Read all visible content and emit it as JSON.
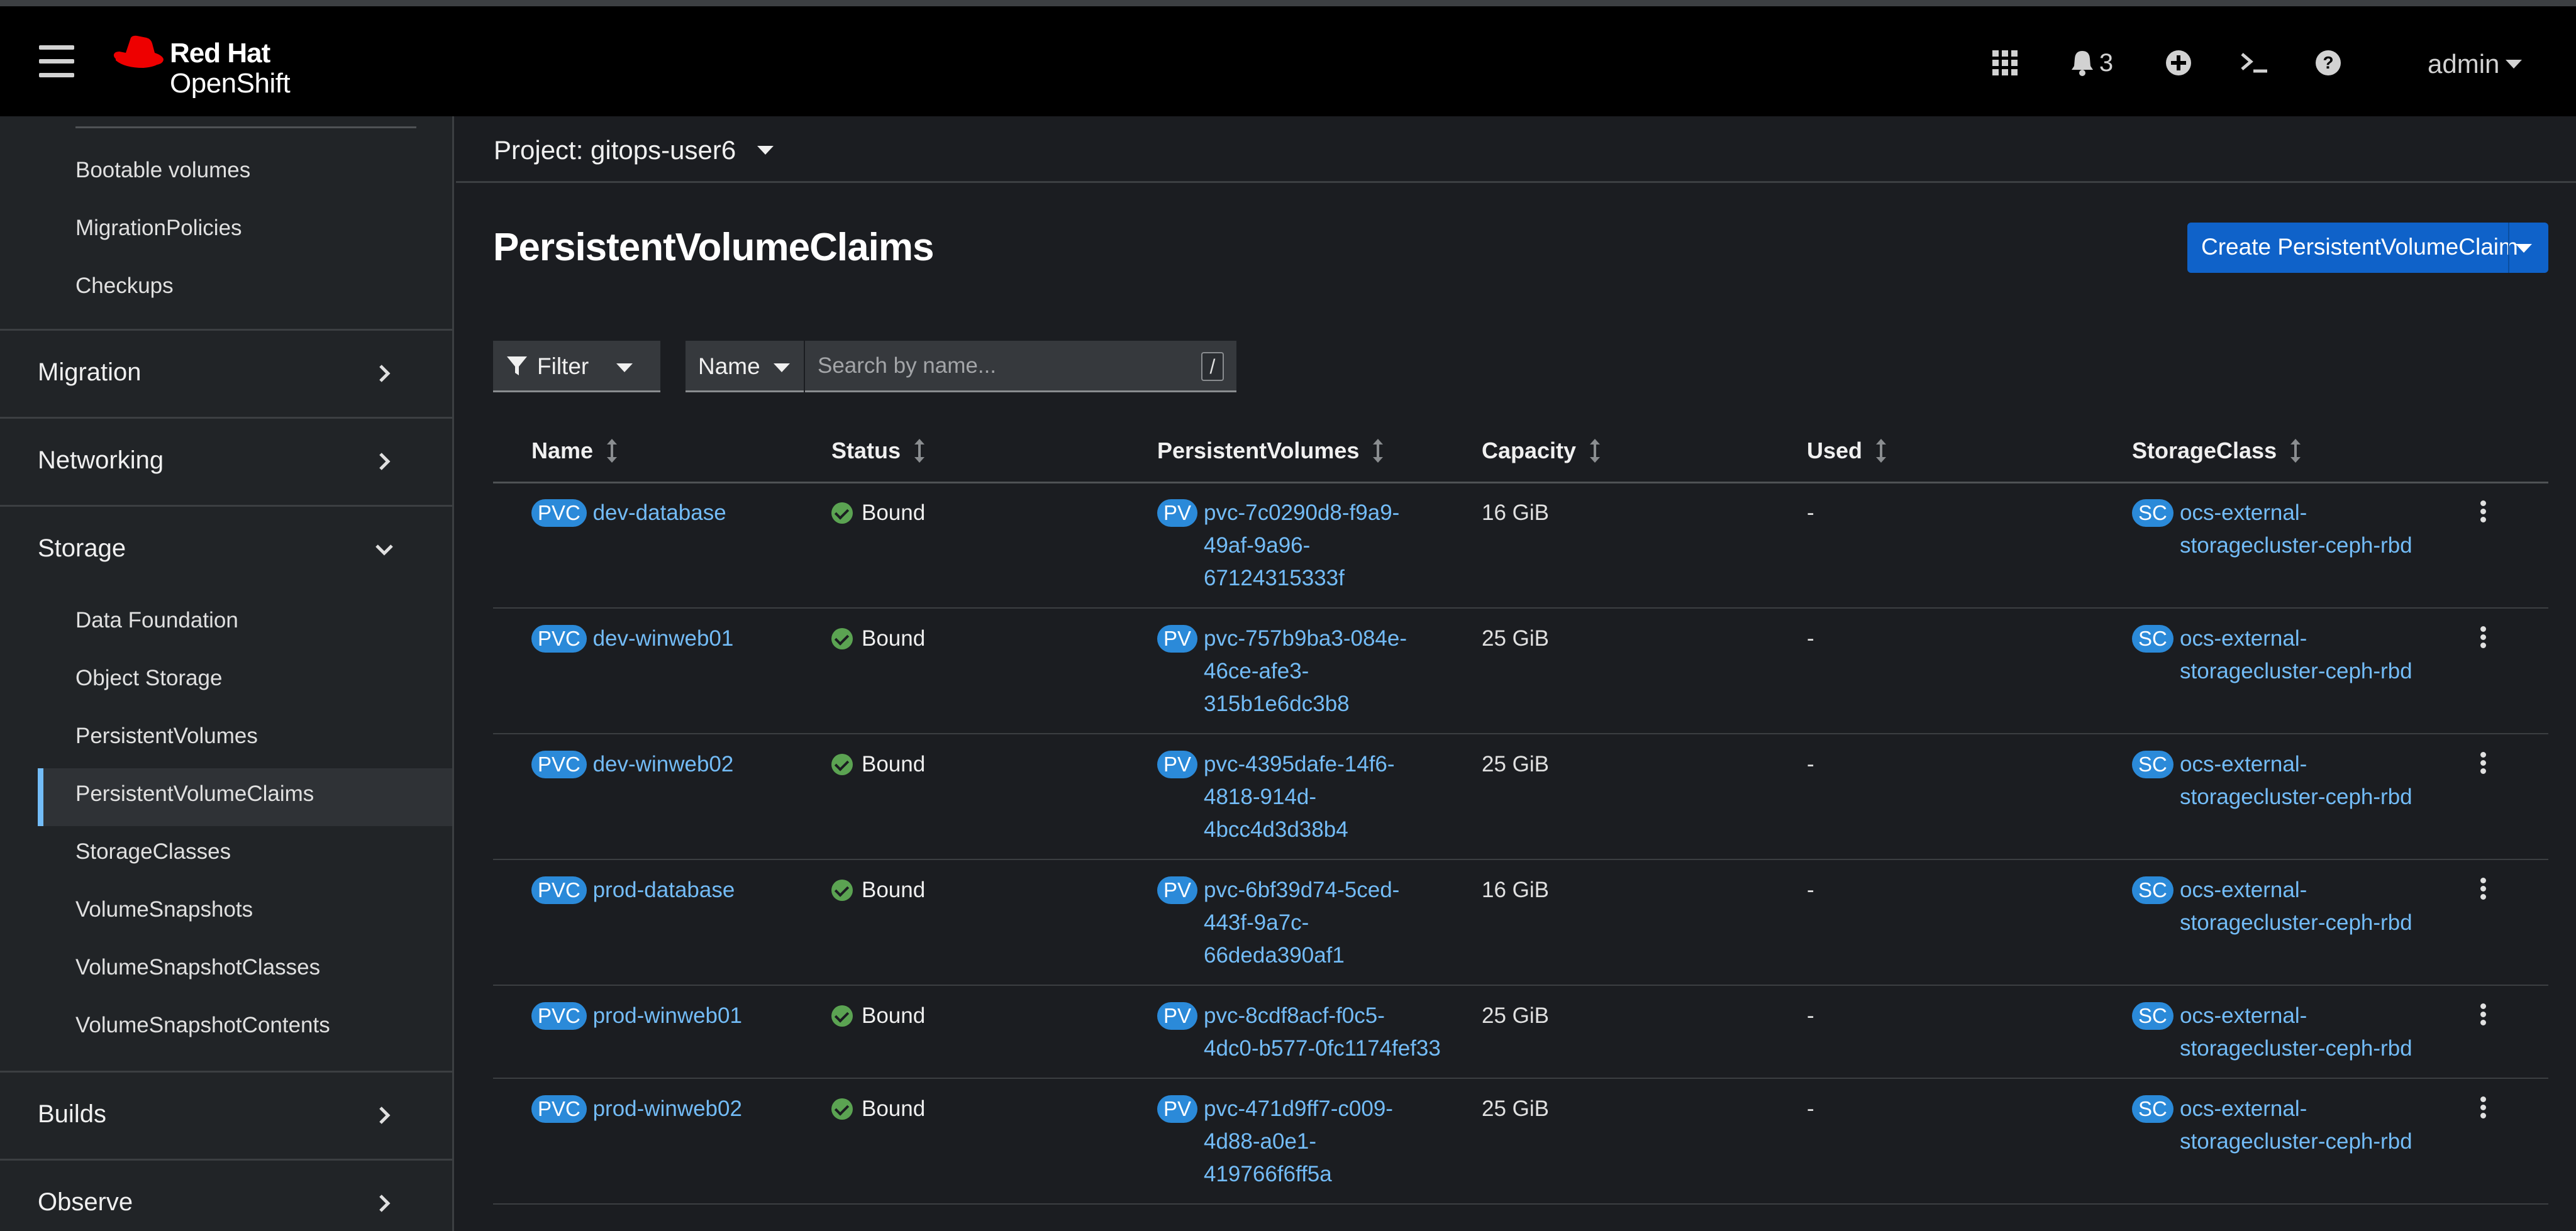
{
  "masthead": {
    "brand_line1": "Red Hat",
    "brand_line2": "OpenShift",
    "icons": [
      "app-launcher-icon",
      "bell-icon",
      "plus-circle-icon",
      "terminal-icon",
      "help-icon"
    ],
    "notification_count": "3",
    "user": "admin"
  },
  "sidebar": {
    "sub_items_top": [
      {
        "label": "Bootable volumes"
      },
      {
        "label": "MigrationPolicies"
      },
      {
        "label": "Checkups"
      }
    ],
    "sections": [
      {
        "label": "Migration",
        "expanded": false
      },
      {
        "label": "Networking",
        "expanded": false
      },
      {
        "label": "Storage",
        "expanded": true
      },
      {
        "label": "Builds",
        "expanded": false
      },
      {
        "label": "Observe",
        "expanded": false
      }
    ],
    "storage_items": [
      {
        "label": "Data Foundation"
      },
      {
        "label": "Object Storage"
      },
      {
        "label": "PersistentVolumes"
      },
      {
        "label": "PersistentVolumeClaims",
        "active": true
      },
      {
        "label": "StorageClasses"
      },
      {
        "label": "VolumeSnapshots"
      },
      {
        "label": "VolumeSnapshotClasses"
      },
      {
        "label": "VolumeSnapshotContents"
      }
    ]
  },
  "project": {
    "label": "Project: gitops-user6"
  },
  "page": {
    "title": "PersistentVolumeClaims",
    "create_button": "Create PersistentVolumeClaim"
  },
  "toolbar": {
    "filter_label": "Filter",
    "attribute_label": "Name",
    "search_placeholder": "Search by name...",
    "search_value": "",
    "shortcut_key": "/"
  },
  "table": {
    "columns": [
      "Name",
      "Status",
      "PersistentVolumes",
      "Capacity",
      "Used",
      "StorageClass"
    ],
    "rows": [
      {
        "badge_name": "PVC",
        "name": "dev-database",
        "status": "Bound",
        "badge_pv": "PV",
        "pv_lines": [
          "pvc-7c0290d8-f9a9-",
          "49af-9a96-",
          "67124315333f"
        ],
        "capacity": "16 GiB",
        "used": "-",
        "badge_sc": "SC",
        "sc_lines": [
          "ocs-external-",
          "storagecluster-ceph-rbd"
        ]
      },
      {
        "badge_name": "PVC",
        "name": "dev-winweb01",
        "status": "Bound",
        "badge_pv": "PV",
        "pv_lines": [
          "pvc-757b9ba3-084e-",
          "46ce-afe3-",
          "315b1e6dc3b8"
        ],
        "capacity": "25 GiB",
        "used": "-",
        "badge_sc": "SC",
        "sc_lines": [
          "ocs-external-",
          "storagecluster-ceph-rbd"
        ]
      },
      {
        "badge_name": "PVC",
        "name": "dev-winweb02",
        "status": "Bound",
        "badge_pv": "PV",
        "pv_lines": [
          "pvc-4395dafe-14f6-",
          "4818-914d-",
          "4bcc4d3d38b4"
        ],
        "capacity": "25 GiB",
        "used": "-",
        "badge_sc": "SC",
        "sc_lines": [
          "ocs-external-",
          "storagecluster-ceph-rbd"
        ]
      },
      {
        "badge_name": "PVC",
        "name": "prod-database",
        "status": "Bound",
        "badge_pv": "PV",
        "pv_lines": [
          "pvc-6bf39d74-5ced-",
          "443f-9a7c-",
          "66deda390af1"
        ],
        "capacity": "16 GiB",
        "used": "-",
        "badge_sc": "SC",
        "sc_lines": [
          "ocs-external-",
          "storagecluster-ceph-rbd"
        ]
      },
      {
        "badge_name": "PVC",
        "name": "prod-winweb01",
        "status": "Bound",
        "badge_pv": "PV",
        "pv_lines": [
          "pvc-8cdf8acf-f0c5-",
          "4dc0-b577-0fc1174fef33"
        ],
        "capacity": "25 GiB",
        "used": "-",
        "badge_sc": "SC",
        "sc_lines": [
          "ocs-external-",
          "storagecluster-ceph-rbd"
        ]
      },
      {
        "badge_name": "PVC",
        "name": "prod-winweb02",
        "status": "Bound",
        "badge_pv": "PV",
        "pv_lines": [
          "pvc-471d9ff7-c009-",
          "4d88-a0e1-",
          "419766f6ff5a"
        ],
        "capacity": "25 GiB",
        "used": "-",
        "badge_sc": "SC",
        "sc_lines": [
          "ocs-external-",
          "storagecluster-ceph-rbd"
        ]
      }
    ]
  },
  "colors": {
    "accent_blue": "#0f62c9",
    "link": "#73bcf7",
    "badge": "#2b8ad9",
    "status_ok": "#5ba352",
    "masthead": "#000000",
    "background": "#1b1d21"
  }
}
